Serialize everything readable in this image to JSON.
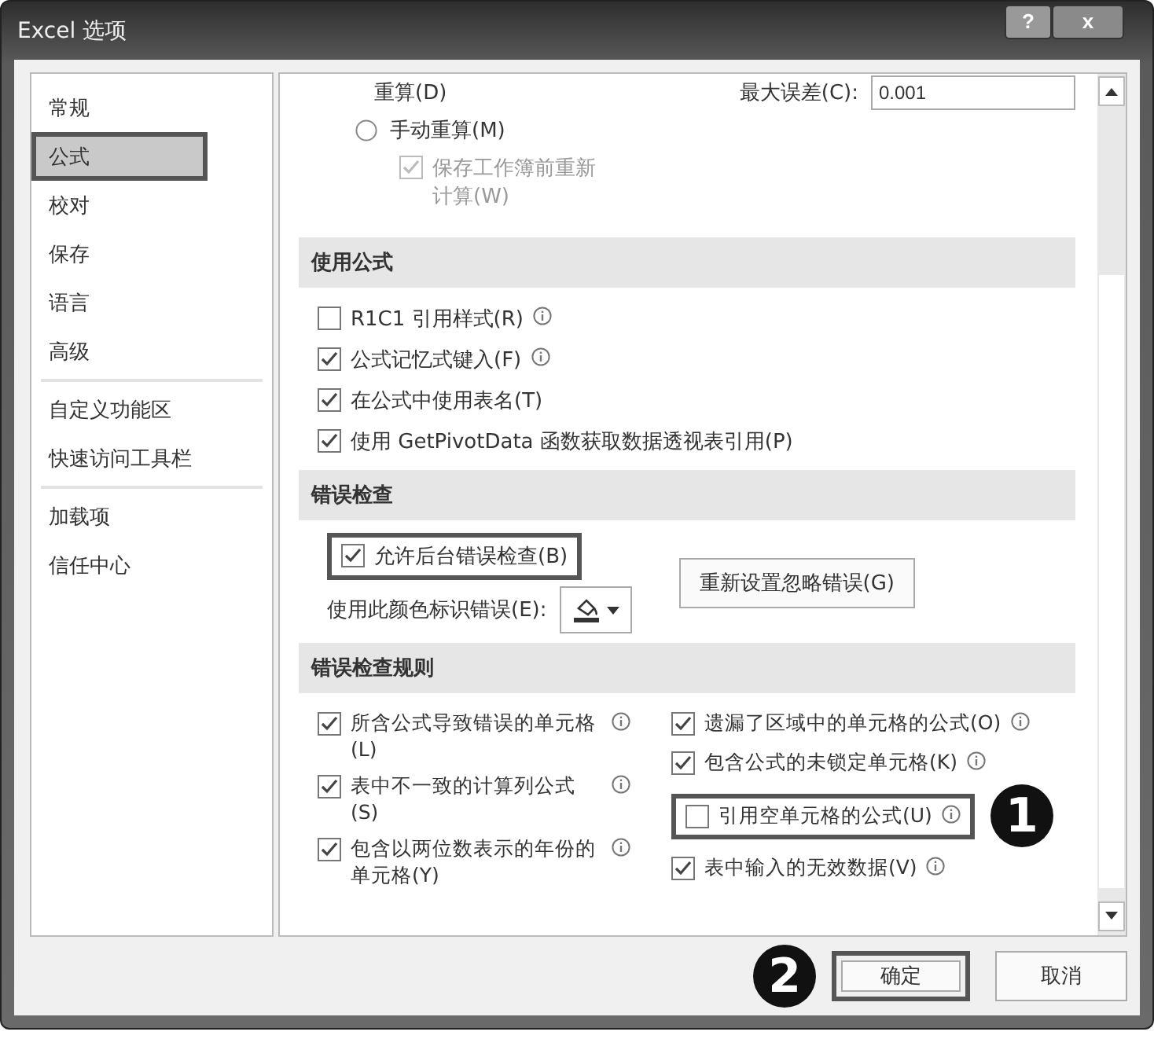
{
  "window": {
    "title": "Excel 选项",
    "help_button": "?",
    "close_button": "x"
  },
  "sidebar": {
    "groups": [
      [
        {
          "label": "常规",
          "selected": false,
          "highlighted": false
        },
        {
          "label": "公式",
          "selected": true,
          "highlighted": true
        },
        {
          "label": "校对",
          "selected": false,
          "highlighted": false
        },
        {
          "label": "保存",
          "selected": false,
          "highlighted": false
        },
        {
          "label": "语言",
          "selected": false,
          "highlighted": false
        },
        {
          "label": "高级",
          "selected": false,
          "highlighted": false
        }
      ],
      [
        {
          "label": "自定义功能区",
          "selected": false,
          "highlighted": false
        },
        {
          "label": "快速访问工具栏",
          "selected": false,
          "highlighted": false
        }
      ],
      [
        {
          "label": "加载项",
          "selected": false,
          "highlighted": false
        },
        {
          "label": "信任中心",
          "selected": false,
          "highlighted": false
        }
      ]
    ]
  },
  "calculation": {
    "automatic_tail": "重算(D)",
    "max_change": {
      "label": "最大误差(C):",
      "value": "0.001"
    },
    "manual": {
      "label": "手动重算(M)",
      "selected": false
    },
    "recalc_before_save": {
      "label": "保存工作簿前重新计算(W)",
      "checked": true,
      "disabled": true
    }
  },
  "working_with_formulas": {
    "title": "使用公式",
    "options": [
      {
        "label": "R1C1 引用样式(R)",
        "checked": false,
        "info": true
      },
      {
        "label": "公式记忆式键入(F)",
        "checked": true,
        "info": true
      },
      {
        "label": "在公式中使用表名(T)",
        "checked": true,
        "info": false
      },
      {
        "label": "使用 GetPivotData 函数获取数据透视表引用(P)",
        "checked": true,
        "info": false
      }
    ]
  },
  "error_checking": {
    "title": "错误检查",
    "enable": {
      "label": "允许后台错误检查(B)",
      "checked": true,
      "highlighted": true
    },
    "color_label": "使用此颜色标识错误(E):",
    "reset_button": "重新设置忽略错误(G)"
  },
  "error_rules": {
    "title": "错误检查规则",
    "columns": [
      [
        {
          "label": "所含公式导致错误的单元格(L)",
          "checked": true,
          "highlighted": false
        },
        {
          "label": "表中不一致的计算列公式(S)",
          "checked": true,
          "highlighted": false
        },
        {
          "label": "包含以两位数表示的年份的单元格(Y)",
          "checked": true,
          "highlighted": false
        }
      ],
      [
        {
          "label": "遗漏了区域中的单元格的公式(O)",
          "checked": true,
          "highlighted": false
        },
        {
          "label": "包含公式的未锁定单元格(K)",
          "checked": true,
          "highlighted": false
        },
        {
          "label": "引用空单元格的公式(U)",
          "checked": false,
          "highlighted": true,
          "callout": "1"
        },
        {
          "label": "表中输入的无效数据(V)",
          "checked": true,
          "highlighted": false
        }
      ]
    ]
  },
  "footer": {
    "ok": {
      "label": "确定",
      "highlighted": true,
      "callout": "2"
    },
    "cancel": {
      "label": "取消",
      "highlighted": false
    }
  }
}
